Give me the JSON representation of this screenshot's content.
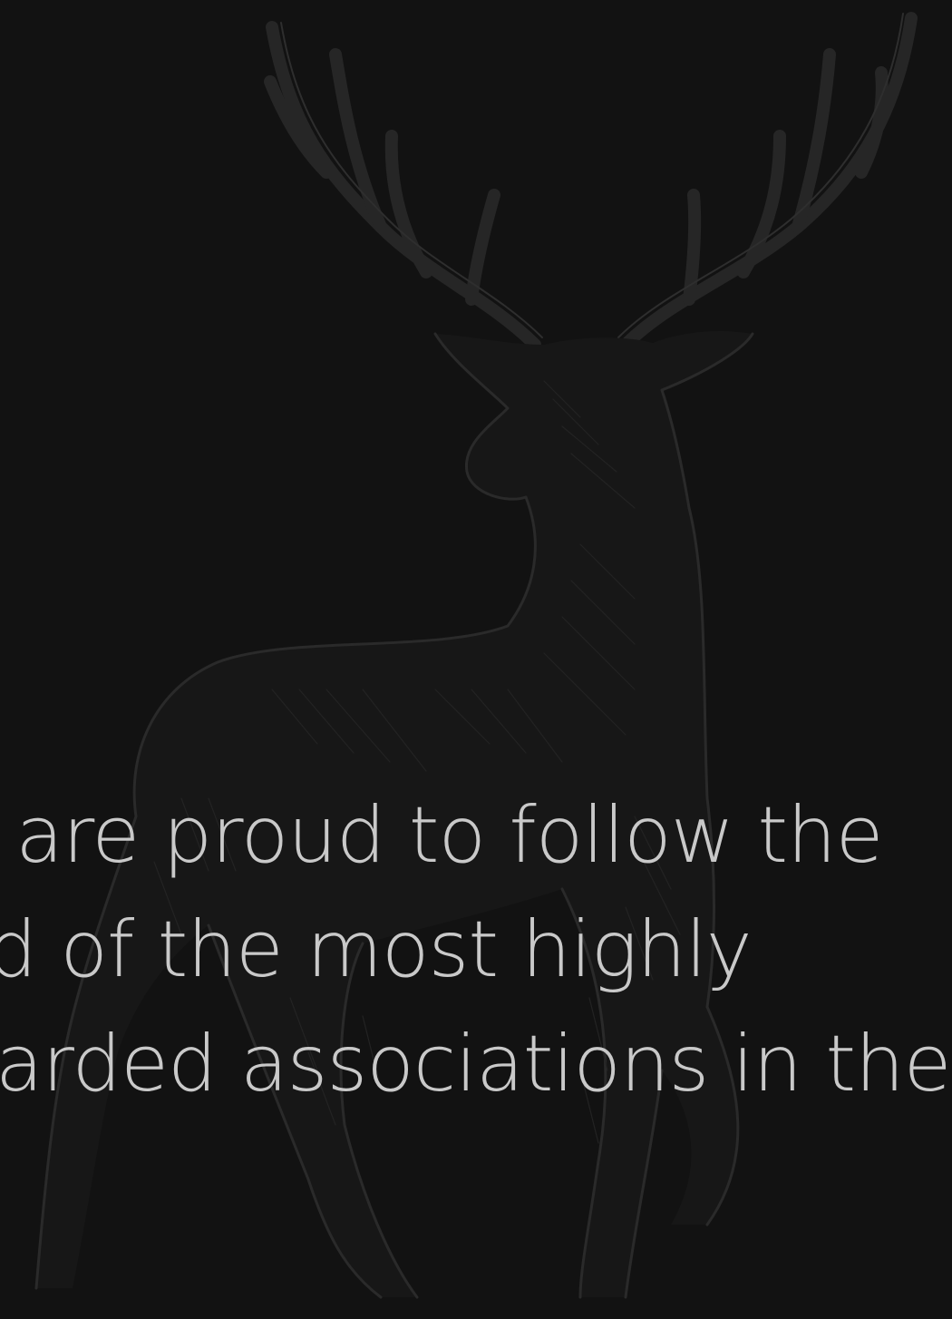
{
  "headline": {
    "line1": "We are proud to follow the",
    "line2": "lead of the most highly",
    "line3": "regarded associations in the industry."
  },
  "colors": {
    "background": "#121212",
    "text": "#c9c9c9",
    "illustration": "#2a2a2a"
  },
  "illustration": {
    "icon": "stag-deer-illustration"
  }
}
